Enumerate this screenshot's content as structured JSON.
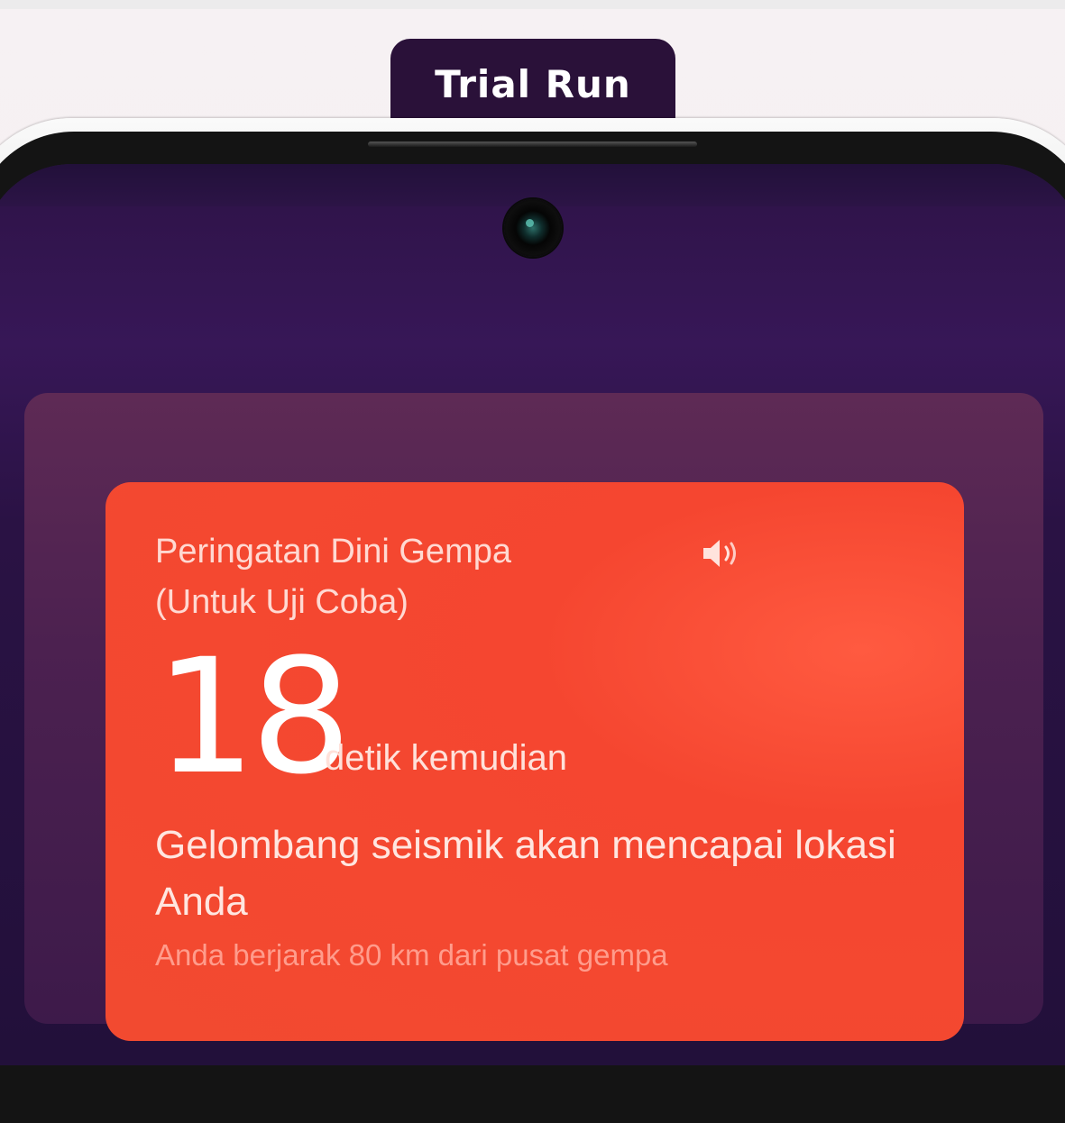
{
  "badge": {
    "label": "Trial Run"
  },
  "alert": {
    "title_line1": "Peringatan Dini Gempa",
    "title_line2": "(Untuk Uji Coba)",
    "countdown_value": "18",
    "countdown_unit": "detik kemudian",
    "message": "Gelombang seismik akan mencapai lokasi Anda",
    "distance_note": "Anda berjarak 80 km dari pusat gempa",
    "sound_icon": "speaker-volume-icon"
  },
  "colors": {
    "badge_bg": "#2a1139",
    "screen_bg": "#2e1347",
    "panel_bg": "#5e2a55",
    "alert_bg": "#f24a30"
  }
}
